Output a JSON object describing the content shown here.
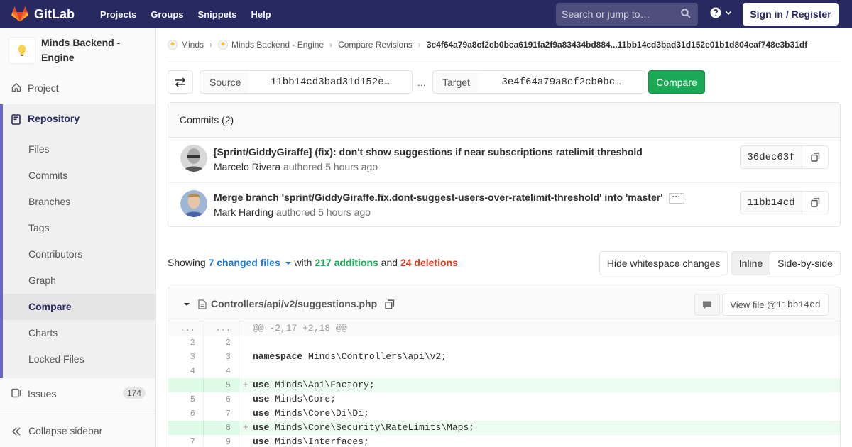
{
  "navbar": {
    "brand": "GitLab",
    "links": [
      "Projects",
      "Groups",
      "Snippets",
      "Help"
    ],
    "search_placeholder": "Search or jump to…",
    "signin_label": "Sign in / Register"
  },
  "sidebar": {
    "project_name": "Minds Backend - Engine",
    "project_label": "Project",
    "repository_label": "Repository",
    "repo_items": [
      "Files",
      "Commits",
      "Branches",
      "Tags",
      "Contributors",
      "Graph",
      "Compare",
      "Charts",
      "Locked Files"
    ],
    "active_item": "Compare",
    "issues_label": "Issues",
    "issues_count": "174",
    "collapse_label": "Collapse sidebar"
  },
  "breadcrumb": {
    "items": [
      "Minds",
      "Minds Backend - Engine",
      "Compare Revisions"
    ],
    "current": "3e4f64a79a8cf2cb0bca6191fa2f9a83434bd884...11bb14cd3bad31d152e01b1d804eaf748e3b31df"
  },
  "compare": {
    "source_label": "Source",
    "source_value": "11bb14cd3bad31d152e…",
    "separator": "...",
    "target_label": "Target",
    "target_value": "3e4f64a79a8cf2cb0bc…",
    "button_label": "Compare"
  },
  "commits": {
    "header": "Commits (2)",
    "rows": [
      {
        "title": "[Sprint/GiddyGiraffe] (fix): don't show suggestions if near subscriptions ratelimit threshold",
        "author": "Marcelo Rivera",
        "meta": " authored 5 hours ago",
        "sha": "36dec63f"
      },
      {
        "title": "Merge branch 'sprint/GiddyGiraffe.fix.dont-suggest-users-over-ratelimit-threshold' into 'master'",
        "author": "Mark Harding",
        "meta": " authored 5 hours ago",
        "sha": "11bb14cd"
      }
    ]
  },
  "summary": {
    "showing": "Showing ",
    "changed": "7 changed files",
    "with": " with ",
    "additions": "217 additions",
    "and": " and ",
    "deletions": "24 deletions",
    "hide_whitespace": "Hide whitespace changes",
    "inline": "Inline",
    "side_by_side": "Side-by-side"
  },
  "file": {
    "path": "Controllers/api/v2/suggestions.php",
    "view_file": "View file @ ",
    "view_sha": "11bb14cd",
    "lines": [
      {
        "old": "...",
        "new": "...",
        "type": "hunk",
        "kw": "",
        "text": "@@ -2,17 +2,18 @@"
      },
      {
        "old": "2",
        "new": "2",
        "type": "ctx",
        "kw": "",
        "text": ""
      },
      {
        "old": "3",
        "new": "3",
        "type": "ctx",
        "kw": "namespace",
        "text": " Minds\\Controllers\\api\\v2;"
      },
      {
        "old": "4",
        "new": "4",
        "type": "ctx",
        "kw": "",
        "text": ""
      },
      {
        "old": "",
        "new": "5",
        "type": "add",
        "kw": "use",
        "text": " Minds\\Api\\Factory;"
      },
      {
        "old": "5",
        "new": "6",
        "type": "ctx",
        "kw": "use",
        "text": " Minds\\Core;"
      },
      {
        "old": "6",
        "new": "7",
        "type": "ctx",
        "kw": "use",
        "text": " Minds\\Core\\Di\\Di;"
      },
      {
        "old": "",
        "new": "8",
        "type": "add",
        "kw": "use",
        "text": " Minds\\Core\\Security\\RateLimits\\Maps;"
      },
      {
        "old": "7",
        "new": "9",
        "type": "ctx",
        "kw": "use",
        "text": " Minds\\Interfaces;"
      }
    ]
  },
  "colors": {
    "navbar": "#292961",
    "accent": "#6666c4",
    "compare_button": "#1aaa55",
    "additions": "#1aaa55",
    "deletions": "#db3b21",
    "link": "#1f78d1"
  }
}
